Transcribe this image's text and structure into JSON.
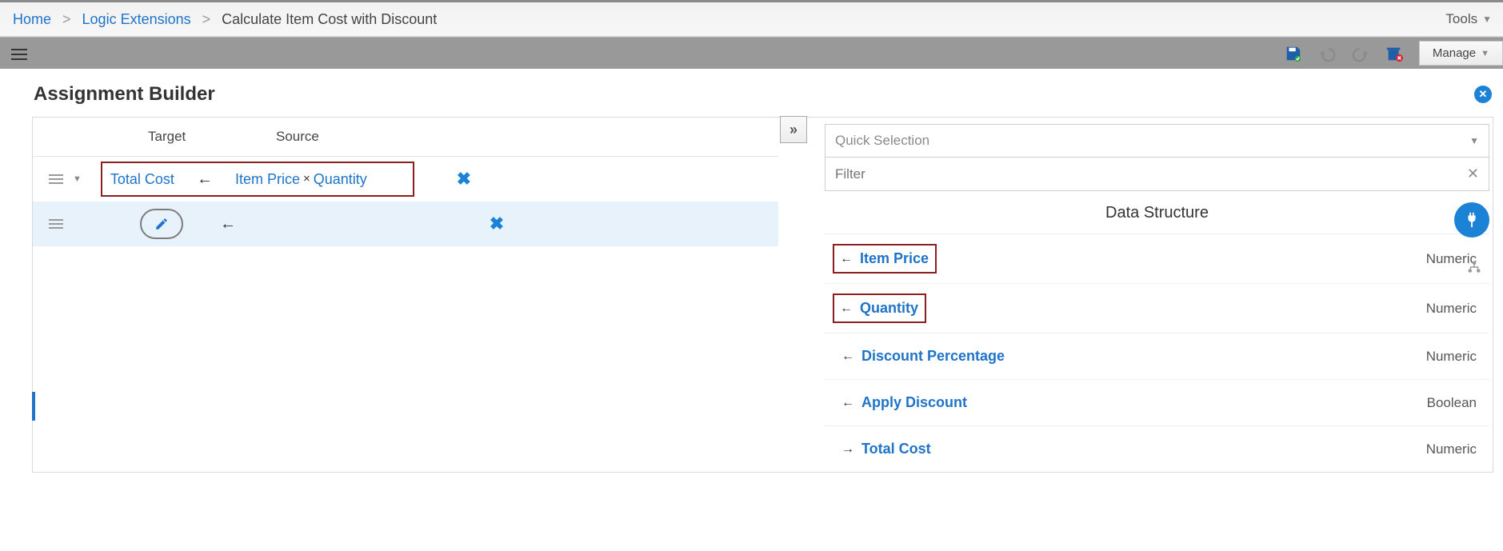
{
  "breadcrumb": {
    "home": "Home",
    "logic_ext": "Logic Extensions",
    "current": "Calculate Item Cost with Discount",
    "tools": "Tools"
  },
  "toolbar": {
    "manage_label": "Manage"
  },
  "modal": {
    "title": "Assignment Builder"
  },
  "columns": {
    "target": "Target",
    "source": "Source"
  },
  "assignment": {
    "target": "Total Cost",
    "source_a": "Item Price",
    "source_op": "×",
    "source_b": "Quantity"
  },
  "right": {
    "quick_selection": "Quick Selection",
    "filter_placeholder": "Filter",
    "ds_heading": "Data Structure"
  },
  "ds_rows": [
    {
      "name": "Item Price",
      "type": "Numeric",
      "dir": "←",
      "red": true
    },
    {
      "name": "Quantity",
      "type": "Numeric",
      "dir": "←",
      "red": true
    },
    {
      "name": "Discount Percentage",
      "type": "Numeric",
      "dir": "←",
      "red": false
    },
    {
      "name": "Apply Discount",
      "type": "Boolean",
      "dir": "←",
      "red": false
    },
    {
      "name": "Total Cost",
      "type": "Numeric",
      "dir": "→",
      "red": false
    }
  ]
}
